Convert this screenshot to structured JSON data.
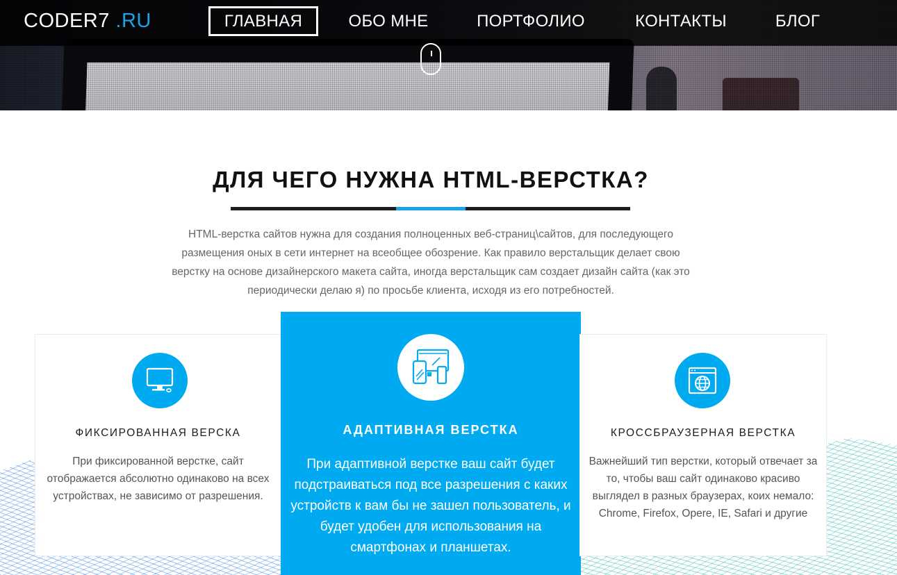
{
  "brand": {
    "logo_main": "CODER7",
    "logo_suffix": ".RU",
    "accent_color": "#1aa3e8"
  },
  "nav": {
    "items": [
      {
        "label": "ГЛАВНАЯ",
        "active": true
      },
      {
        "label": "ОБО МНЕ",
        "active": false
      },
      {
        "label": "ПОРТФОЛИО",
        "active": false
      },
      {
        "label": "КОНТАКТЫ",
        "active": false
      },
      {
        "label": "БЛОГ",
        "active": false
      }
    ]
  },
  "hero": {
    "scroll_icon": "mouse-scroll-icon"
  },
  "section": {
    "title": "ДЛЯ ЧЕГО НУЖНА HTML-ВЕРСТКА?",
    "intro": "HTML-верстка сайтов нужна для создания полноценных веб-страниц\\сайтов, для последующего размещения оных в сети интернет на всеобщее обозрение. Как правило верстальщик делает свою верстку на основе дизайнерского макета сайта, иногда верстальщик сам создает дизайн сайта (как это периодически делаю я) по просьбе клиента, исходя из его потребностей."
  },
  "cards": [
    {
      "icon": "desktop-monitor-icon",
      "title": "ФИКСИРОВАННАЯ ВЕРСКА",
      "text": "При фиксированной верстке, сайт отображается абсолютно одинаково на всех устройствах, не зависимо от разрешения."
    },
    {
      "icon": "responsive-devices-icon",
      "title": "АДАПТИВНАЯ ВЕРСТКА",
      "text": "При адаптивной верстке ваш сайт будет подстраиваться под все разрешения с каких устройств к вам бы не зашел пользователь, и будет удобен для использования на смартфонах и планшетах.",
      "highlight_color": "#00aaf0"
    },
    {
      "icon": "browser-globe-icon",
      "title": "КРОССБРАУЗЕРНАЯ ВЕРСТКА",
      "text": "Важнейший тип верстки, который отвечает за то, чтобы ваш сайт одинаково красиво выглядел в разных браузерах, коих немало: Chrome, Firefox, Opere, IE, Safari и другие"
    }
  ]
}
